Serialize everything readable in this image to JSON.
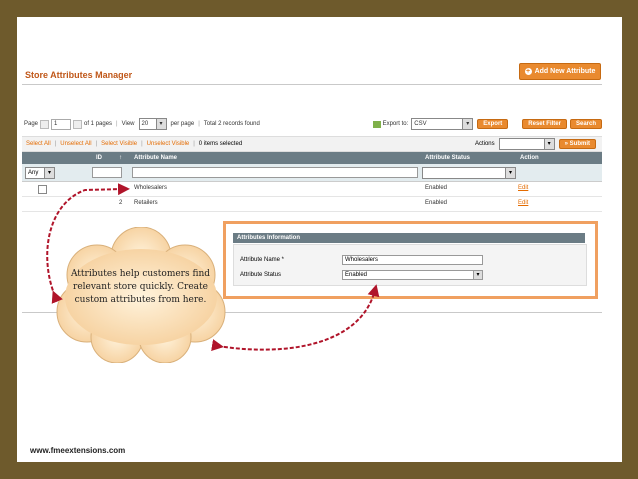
{
  "page": {
    "title": "Store Attributes Manager",
    "add_button": "Add New Attribute",
    "footer": "www.fmeextensions.com"
  },
  "pager": {
    "page_label": "Page",
    "page_value": "1",
    "of_pages": "of 1 pages",
    "view_label": "View",
    "view_value": "20",
    "per_page": "per page",
    "total": "Total 2 records found",
    "export_label": "Export to:",
    "export_value": "CSV",
    "export_button": "Export",
    "reset_button": "Reset Filter",
    "search_button": "Search"
  },
  "massaction": {
    "select_all": "Select All",
    "unselect_all": "Unselect All",
    "select_visible": "Select Visible",
    "unselect_visible": "Unselect Visible",
    "items_selected": "0 items selected",
    "actions_label": "Actions",
    "submit_button": "Submit"
  },
  "grid": {
    "headers": {
      "id": "ID",
      "name": "Attribute Name",
      "status": "Attribute Status",
      "action": "Action"
    },
    "filter_any": "Any",
    "rows": [
      {
        "id": "1",
        "name": "Wholesalers",
        "status": "Enabled",
        "action": "Edit"
      },
      {
        "id": "2",
        "name": "Retailers",
        "status": "Enabled",
        "action": "Edit"
      }
    ]
  },
  "popup": {
    "header": "Attributes Information",
    "name_label": "Attribute Name *",
    "name_value": "Wholesalers",
    "status_label": "Attribute Status",
    "status_value": "Enabled"
  },
  "callout": {
    "text": "Attributes help customers find relevant store quickly. Create custom attributes from here."
  },
  "colors": {
    "frame": "#6e5a2c",
    "accent": "#e98a2f",
    "title": "#c0581a",
    "arrow": "#b0142a"
  }
}
